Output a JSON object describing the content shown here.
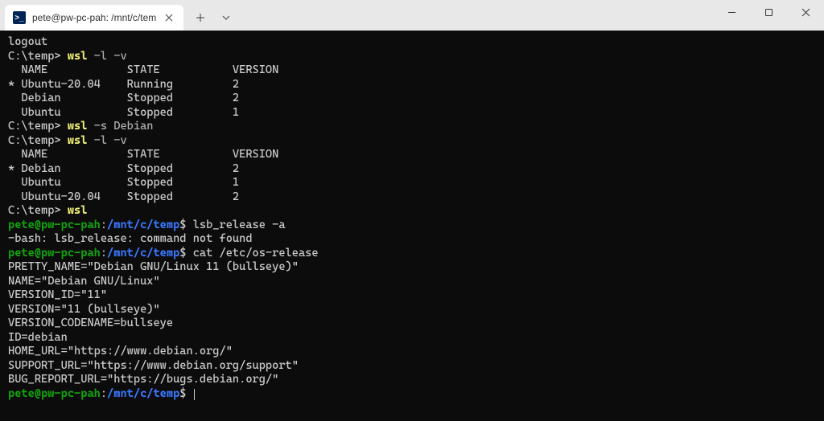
{
  "tab": {
    "icon_glyph": ">_",
    "title": "pete@pw-pc-pah: /mnt/c/tem"
  },
  "win_prompt": "C:\\temp>",
  "cmd": {
    "wsl": "wsl",
    "args_lv": "-l -v",
    "args_s_debian": "-s Debian"
  },
  "bash_prompt": {
    "userhost": "pete@pw-pc-pah",
    "colon": ":",
    "path": "/mnt/c/temp",
    "dollar": "$"
  },
  "lines": {
    "logout": "logout",
    "header": "  NAME            STATE           VERSION",
    "list1_row1": "* Ubuntu-20.04    Running         2",
    "list1_row2": "  Debian          Stopped         2",
    "list1_row3": "  Ubuntu          Stopped         1",
    "list2_row1": "* Debian          Stopped         2",
    "list2_row2": "  Ubuntu          Stopped         1",
    "list2_row3": "  Ubuntu-20.04    Stopped         2",
    "bash_cmd1": "lsb_release -a",
    "bash_err": "-bash: lsb_release: command not found",
    "bash_cmd2": "cat /etc/os-release",
    "os1": "PRETTY_NAME=\"Debian GNU/Linux 11 (bullseye)\"",
    "os2": "NAME=\"Debian GNU/Linux\"",
    "os3": "VERSION_ID=\"11\"",
    "os4": "VERSION=\"11 (bullseye)\"",
    "os5": "VERSION_CODENAME=bullseye",
    "os6": "ID=debian",
    "os7": "HOME_URL=\"https://www.debian.org/\"",
    "os8": "SUPPORT_URL=\"https://www.debian.org/support\"",
    "os9": "BUG_REPORT_URL=\"https://bugs.debian.org/\""
  }
}
